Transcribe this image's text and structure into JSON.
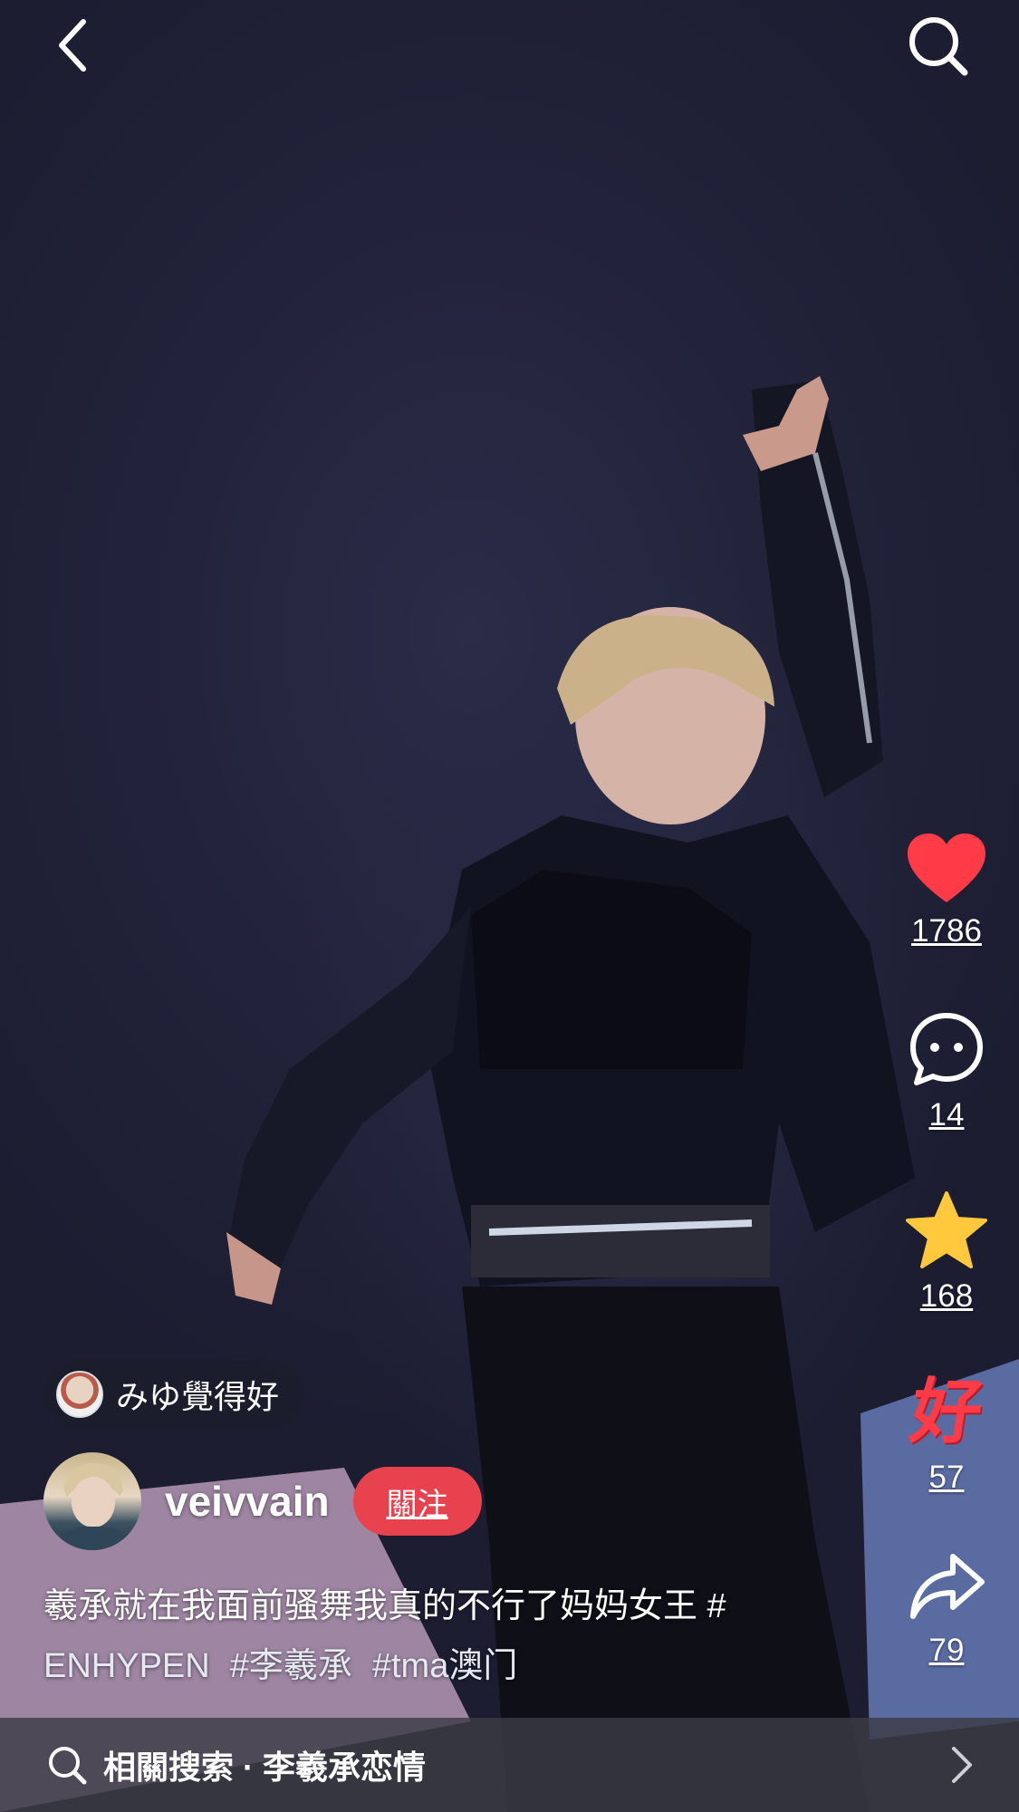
{
  "top_bar": {
    "back_icon": "chevron-left-icon",
    "search_icon": "search-icon"
  },
  "actions": {
    "like_count": "1786",
    "comment_count": "14",
    "favorite_count": "168",
    "good_count": "57",
    "good_label": "好",
    "share_count": "79",
    "like_color": "#ff3b47",
    "favorite_color": "#ffc83d",
    "good_color": "#ff3b47"
  },
  "recommend": {
    "text": "みゆ覺得好"
  },
  "author": {
    "name": "veivvain",
    "follow_label": "關注"
  },
  "caption": {
    "text": "羲承就在我面前骚舞我真的不行了妈妈女王 #",
    "tags": [
      "ENHYPEN",
      "#李羲承",
      "#tma澳门"
    ]
  },
  "related_search": {
    "text": "相關搜索 · 李羲承恋情"
  }
}
